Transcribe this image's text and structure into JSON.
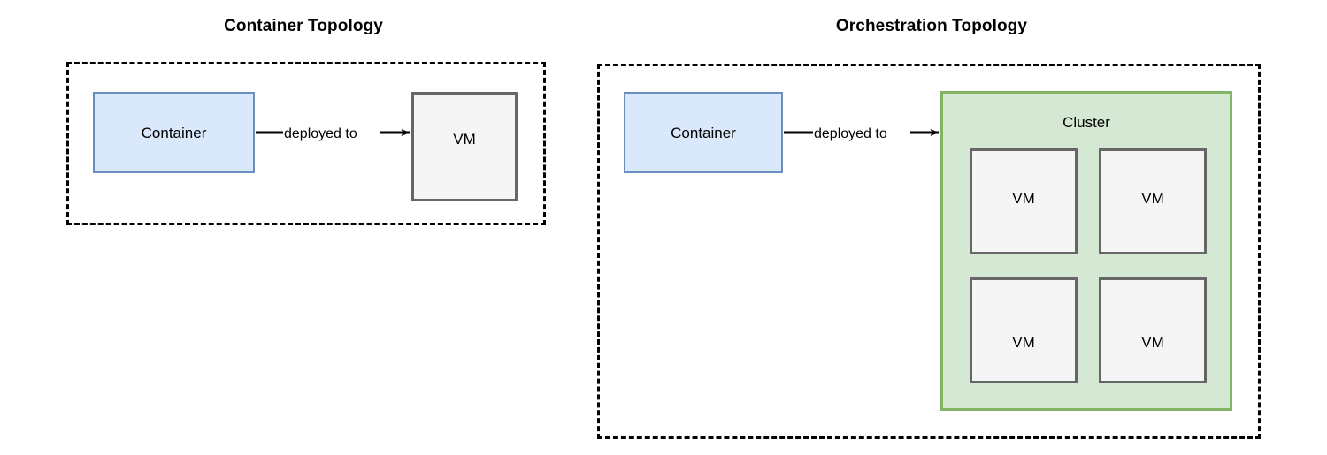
{
  "diagram": {
    "background_color": "#ffffff",
    "panels": [
      {
        "id": "container-topology",
        "title": "Container Topology",
        "boundary_style": "dashed",
        "boundary_color": "#000000",
        "nodes": [
          {
            "id": "container-left",
            "label": "Container",
            "shape": "rectangle",
            "fill": "#dae8fc",
            "stroke": "#6c8ebf"
          },
          {
            "id": "vm-left",
            "label": "VM",
            "shape": "rectangle",
            "fill": "#f5f5f5",
            "stroke": "#666666"
          }
        ],
        "edges": [
          {
            "id": "edge-left",
            "label": "deployed to",
            "from": "container-left",
            "to": "vm-left",
            "arrow": "filled-triangle",
            "color": "#000000"
          }
        ]
      },
      {
        "id": "orchestration-topology",
        "title": "Orchestration Topology",
        "boundary_style": "dashed",
        "boundary_color": "#000000",
        "nodes": [
          {
            "id": "container-right",
            "label": "Container",
            "shape": "rectangle",
            "fill": "#dae8fc",
            "stroke": "#6c8ebf"
          }
        ],
        "group": {
          "id": "cluster",
          "label": "Cluster",
          "fill": "#d5e8d4",
          "stroke": "#82b366",
          "members": [
            {
              "id": "cluster-vm-0",
              "label": "VM",
              "fill": "#f5f5f5",
              "stroke": "#666666"
            },
            {
              "id": "cluster-vm-1",
              "label": "VM",
              "fill": "#f5f5f5",
              "stroke": "#666666"
            },
            {
              "id": "cluster-vm-2",
              "label": "VM",
              "fill": "#f5f5f5",
              "stroke": "#666666"
            },
            {
              "id": "cluster-vm-3",
              "label": "VM",
              "fill": "#f5f5f5",
              "stroke": "#666666"
            }
          ]
        },
        "edges": [
          {
            "id": "edge-right",
            "label": "deployed to",
            "from": "container-right",
            "to": "cluster",
            "arrow": "filled-triangle",
            "color": "#000000"
          }
        ]
      }
    ]
  }
}
